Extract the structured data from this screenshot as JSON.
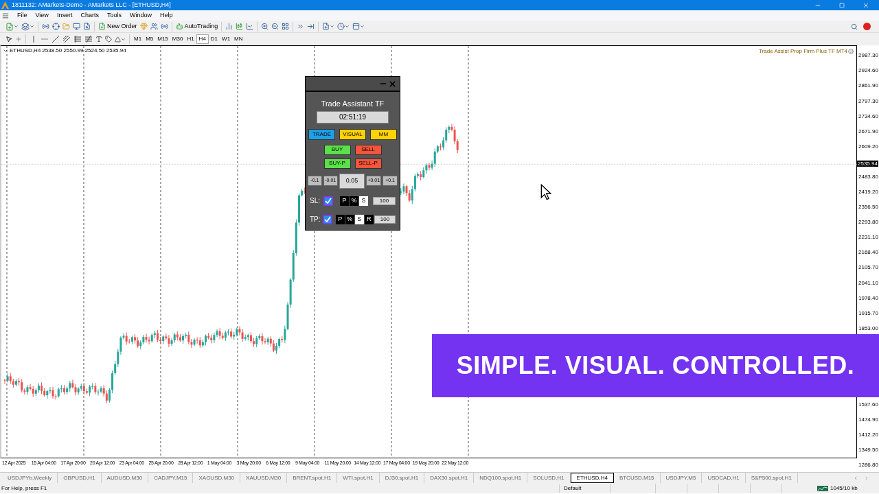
{
  "window": {
    "title": "1811132: AMarkets-Demo - AMarkets LLC - [ETHUSD,H4]"
  },
  "menu": [
    "File",
    "View",
    "Insert",
    "Charts",
    "Tools",
    "Window",
    "Help"
  ],
  "toolbar": {
    "new_order": "New Order",
    "autotrading": "AutoTrading"
  },
  "timeframes": [
    {
      "label": "M1",
      "selected": false
    },
    {
      "label": "M5",
      "selected": false
    },
    {
      "label": "M15",
      "selected": false
    },
    {
      "label": "M30",
      "selected": false
    },
    {
      "label": "H1",
      "selected": false
    },
    {
      "label": "H4",
      "selected": true
    },
    {
      "label": "D1",
      "selected": false
    },
    {
      "label": "W1",
      "selected": false
    },
    {
      "label": "MN",
      "selected": false
    }
  ],
  "chart": {
    "symbol": "ETHUSD,H4",
    "ohlc": "2538.50 2550.99 2524.50 2535.94",
    "indicator": "Trade Assist Prop Firm Plus TF MT4",
    "current_price": "2535.94",
    "price_axis": [
      "2987.30",
      "2924.60",
      "2861.90",
      "2797.30",
      "2734.60",
      "2671.90",
      "2609.20",
      "2483.80",
      "2419.20",
      "2356.50",
      "2293.80",
      "2231.10",
      "2168.40",
      "2105.70",
      "2041.10",
      "1978.40",
      "1915.70",
      "1853.00",
      "1537.60",
      "1474.90",
      "1412.20",
      "1349.50",
      "1286.80"
    ],
    "time_axis": [
      "12 Apr 2025",
      "15 Apr 04:00",
      "17 Apr 20:00",
      "20 Apr 12:00",
      "23 Apr 04:00",
      "25 Apr 20:00",
      "28 Apr 12:00",
      "1 May 04:00",
      "3 May 20:00",
      "6 May 12:00",
      "9 May 04:00",
      "11 May 20:00",
      "14 May 12:00",
      "17 May 04:00",
      "19 May 20:00",
      "22 May 12:00"
    ]
  },
  "panel": {
    "title": "Trade Assistant TF",
    "timer": "02:51:19",
    "mode_tabs": [
      {
        "label": "TRADE",
        "color": "#1ea0e8"
      },
      {
        "label": "VISUAL",
        "color": "#ffd200"
      },
      {
        "label": "MM",
        "color": "#ffd200"
      }
    ],
    "order_buttons": [
      {
        "label": "BUY",
        "color": "#5ce04a"
      },
      {
        "label": "SELL",
        "color": "#f5553a"
      },
      {
        "label": "BUY-P",
        "color": "#5ce04a"
      },
      {
        "label": "SELL-P",
        "color": "#f5553a"
      }
    ],
    "lot_down": [
      "-0.1",
      "-0.01"
    ],
    "lot": "0.05",
    "lot_up": [
      "+0.01",
      "+0.1"
    ],
    "sl": {
      "label": "SL:",
      "checked": true,
      "options": [
        {
          "label": "P",
          "selected": false
        },
        {
          "label": "%",
          "selected": false
        },
        {
          "label": "S",
          "selected": true
        }
      ],
      "value": "100"
    },
    "tp": {
      "label": "TP:",
      "checked": true,
      "options": [
        {
          "label": "P",
          "selected": false
        },
        {
          "label": "%",
          "selected": false
        },
        {
          "label": "S",
          "selected": true
        },
        {
          "label": "R",
          "selected": false
        }
      ],
      "value": "100"
    }
  },
  "banner": "SIMPLE. VISUAL. CONTROLLED.",
  "symbol_tabs": [
    {
      "label": "USDJPYb,Weekly",
      "selected": false
    },
    {
      "label": "GBPUSD,H1",
      "selected": false
    },
    {
      "label": "AUDUSD,M30",
      "selected": false
    },
    {
      "label": "CADJPY,M15",
      "selected": false
    },
    {
      "label": "XAGUSD,M30",
      "selected": false
    },
    {
      "label": "XAUUSD,M30",
      "selected": false
    },
    {
      "label": "BRENT.spot,H1",
      "selected": false
    },
    {
      "label": "WTI.spot,H1",
      "selected": false
    },
    {
      "label": "DJ30.spot,H1",
      "selected": false
    },
    {
      "label": "DAX30.spot,H1",
      "selected": false
    },
    {
      "label": "NDQ100.spot,H1",
      "selected": false
    },
    {
      "label": "SOLUSD,H1",
      "selected": false
    },
    {
      "label": "ETHUSD,H4",
      "selected": true
    },
    {
      "label": "BTCUSD,M15",
      "selected": false
    },
    {
      "label": "USDJPY,M5",
      "selected": false
    },
    {
      "label": "USDCAD,H1",
      "selected": false
    },
    {
      "label": "S&P500.spot,H1",
      "selected": false
    }
  ],
  "status_bar": {
    "help": "For Help, press F1",
    "profile": "Default",
    "traffic": "1045/10 kb"
  }
}
